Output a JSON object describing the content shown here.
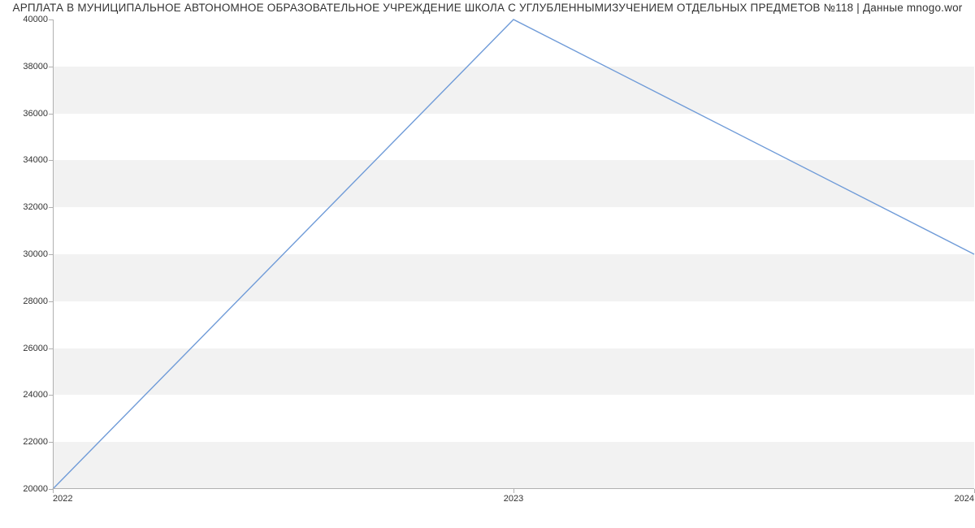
{
  "chart_data": {
    "type": "line",
    "title": "АРПЛАТА В МУНИЦИПАЛЬНОЕ АВТОНОМНОЕ ОБРАЗОВАТЕЛЬНОЕ УЧРЕЖДЕНИЕ ШКОЛА С УГЛУБЛЕННЫМИЗУЧЕНИЕМ ОТДЕЛЬНЫХ ПРЕДМЕТОВ №118 | Данные mnogo.wor",
    "x": [
      2022,
      2023,
      2024
    ],
    "values": [
      20000,
      40000,
      30000
    ],
    "xlabel": "",
    "ylabel": "",
    "xlim": [
      2022,
      2024
    ],
    "ylim": [
      20000,
      40000
    ],
    "y_ticks": [
      20000,
      22000,
      24000,
      26000,
      28000,
      30000,
      32000,
      34000,
      36000,
      38000,
      40000
    ],
    "x_ticks": [
      2022,
      2023,
      2024
    ],
    "line_color": "#6f9bd8",
    "band_color": "#f2f2f2"
  }
}
